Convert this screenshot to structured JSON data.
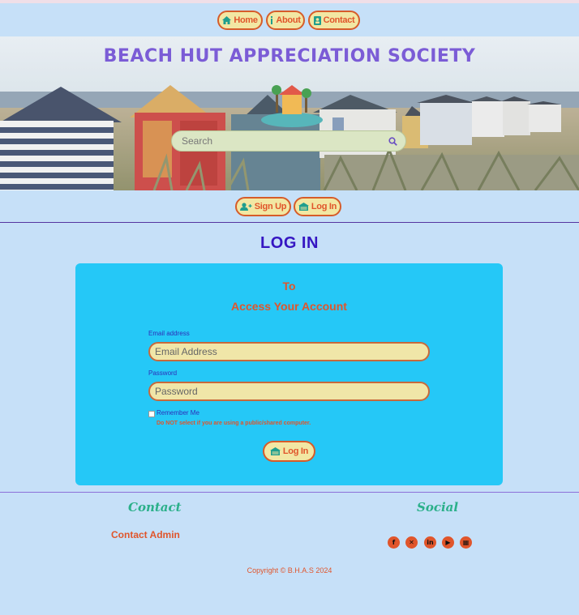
{
  "nav": {
    "home": "Home",
    "about": "About",
    "contact": "Contact"
  },
  "hero": {
    "title": "BEACH HUT APPRECIATION SOCIETY",
    "search_placeholder": "Search"
  },
  "auth": {
    "sign_up": "Sign Up",
    "log_in": "Log In"
  },
  "page": {
    "heading": "LOG IN"
  },
  "form": {
    "title_to": "To",
    "title_sub": "Access Your Account",
    "email_label": "Email address",
    "email_placeholder": "Email Address",
    "password_label": "Password",
    "password_placeholder": "Password",
    "remember_label": "Remember Me",
    "remember_warning": "Do NOT select if you are using a public/shared computer.",
    "submit": "Log In"
  },
  "footer": {
    "contact_heading": "Contact",
    "contact_link": "Contact Admin",
    "social_heading": "Social",
    "social_icons": [
      "facebook-icon",
      "x-icon",
      "linkedin-icon",
      "youtube-icon",
      "calendar-icon"
    ],
    "copyright": "Copyright © B.H.A.S 2024"
  },
  "colors": {
    "background": "#c6e0f8",
    "accent_orange": "#e0552b",
    "pill_fill": "#f2e7a3",
    "card_blue": "#25c8f7",
    "heading_purple": "#3516c2",
    "title_purple": "#7b5cd6",
    "footer_teal": "#2bb08a"
  }
}
